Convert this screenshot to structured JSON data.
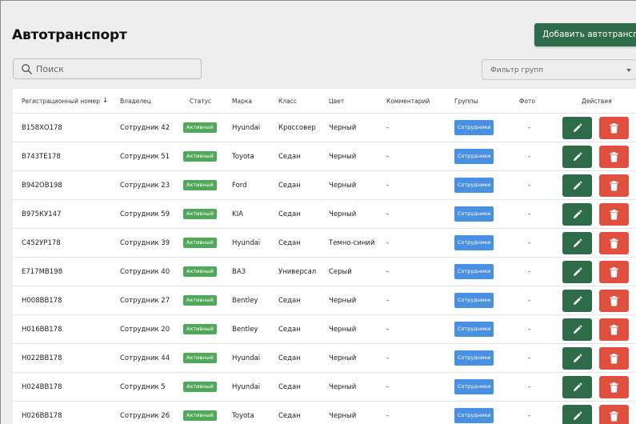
{
  "header": {
    "title": "Автотранспорт",
    "add_button_label": "Добавить автотранспорт"
  },
  "filters": {
    "search_placeholder": "Поиск",
    "group_filter_placeholder": "Фильтр групп"
  },
  "table": {
    "columns": {
      "reg_number": "Регистрационный номер",
      "owner": "Владелец",
      "status": "Статус",
      "brand": "Марка",
      "class": "Класс",
      "color": "Цвет",
      "comment": "Комментарий",
      "groups": "Группы",
      "photo": "Фото",
      "actions": "Действия"
    },
    "rows": [
      {
        "reg": "В158ХО178",
        "owner": "Сотрудник 42",
        "status": "Активный",
        "brand": "Hyundai",
        "class": "Кроссовер",
        "color": "Черный",
        "comment": "-",
        "groups": "Сотрудники",
        "photo": "-"
      },
      {
        "reg": "В743ТЕ178",
        "owner": "Сотрудник 51",
        "status": "Активный",
        "brand": "Toyota",
        "class": "Седан",
        "color": "Черный",
        "comment": "-",
        "groups": "Сотрудники",
        "photo": "-"
      },
      {
        "reg": "В942ОВ198",
        "owner": "Сотрудник 23",
        "status": "Активный",
        "brand": "Ford",
        "class": "Седан",
        "color": "Черный",
        "comment": "-",
        "groups": "Сотрудники",
        "photo": "-"
      },
      {
        "reg": "В975КУ147",
        "owner": "Сотрудник 59",
        "status": "Активный",
        "brand": "KIA",
        "class": "Седан",
        "color": "Черный",
        "comment": "-",
        "groups": "Сотрудники",
        "photo": "-"
      },
      {
        "reg": "С452УР178",
        "owner": "Сотрудник 39",
        "status": "Активный",
        "brand": "Hyundai",
        "class": "Седан",
        "color": "Темно-синий",
        "comment": "-",
        "groups": "Сотрудники",
        "photo": "-"
      },
      {
        "reg": "Е717МВ198",
        "owner": "Сотрудник 40",
        "status": "Активный",
        "brand": "ВАЗ",
        "class": "Универсал",
        "color": "Серый",
        "comment": "-",
        "groups": "Сотрудники",
        "photo": "-"
      },
      {
        "reg": "Н008ВВ178",
        "owner": "Сотрудник 27",
        "status": "Активный",
        "brand": "Bentley",
        "class": "Седан",
        "color": "Черный",
        "comment": "-",
        "groups": "Сотрудники",
        "photo": "-"
      },
      {
        "reg": "Н016ВВ178",
        "owner": "Сотрудник 20",
        "status": "Активный",
        "brand": "Bentley",
        "class": "Седан",
        "color": "Черный",
        "comment": "-",
        "groups": "Сотрудники",
        "photo": "-"
      },
      {
        "reg": "Н022ВВ178",
        "owner": "Сотрудник 44",
        "status": "Активный",
        "brand": "Hyundai",
        "class": "Седан",
        "color": "Черный",
        "comment": "-",
        "groups": "Сотрудники",
        "photo": "-"
      },
      {
        "reg": "Н024ВВ178",
        "owner": "Сотрудник 5",
        "status": "Активный",
        "brand": "Hyundai",
        "class": "Седан",
        "color": "Черный",
        "comment": "-",
        "groups": "Сотрудники",
        "photo": "-"
      },
      {
        "reg": "Н026ВВ178",
        "owner": "Сотрудник 26",
        "status": "Активный",
        "brand": "Toyota",
        "class": "Седан",
        "color": "Черный",
        "comment": "-",
        "groups": "Сотрудники",
        "photo": "-"
      }
    ]
  },
  "colors": {
    "primary_green": "#2e6b48",
    "status_green": "#52a85a",
    "groups_blue": "#4a90e2",
    "delete_red": "#e0503e"
  },
  "icons": {
    "search": "search-icon",
    "sort": "arrow-down-icon",
    "dropdown": "chevron-down-icon",
    "edit": "pencil-icon",
    "delete": "trash-icon"
  }
}
